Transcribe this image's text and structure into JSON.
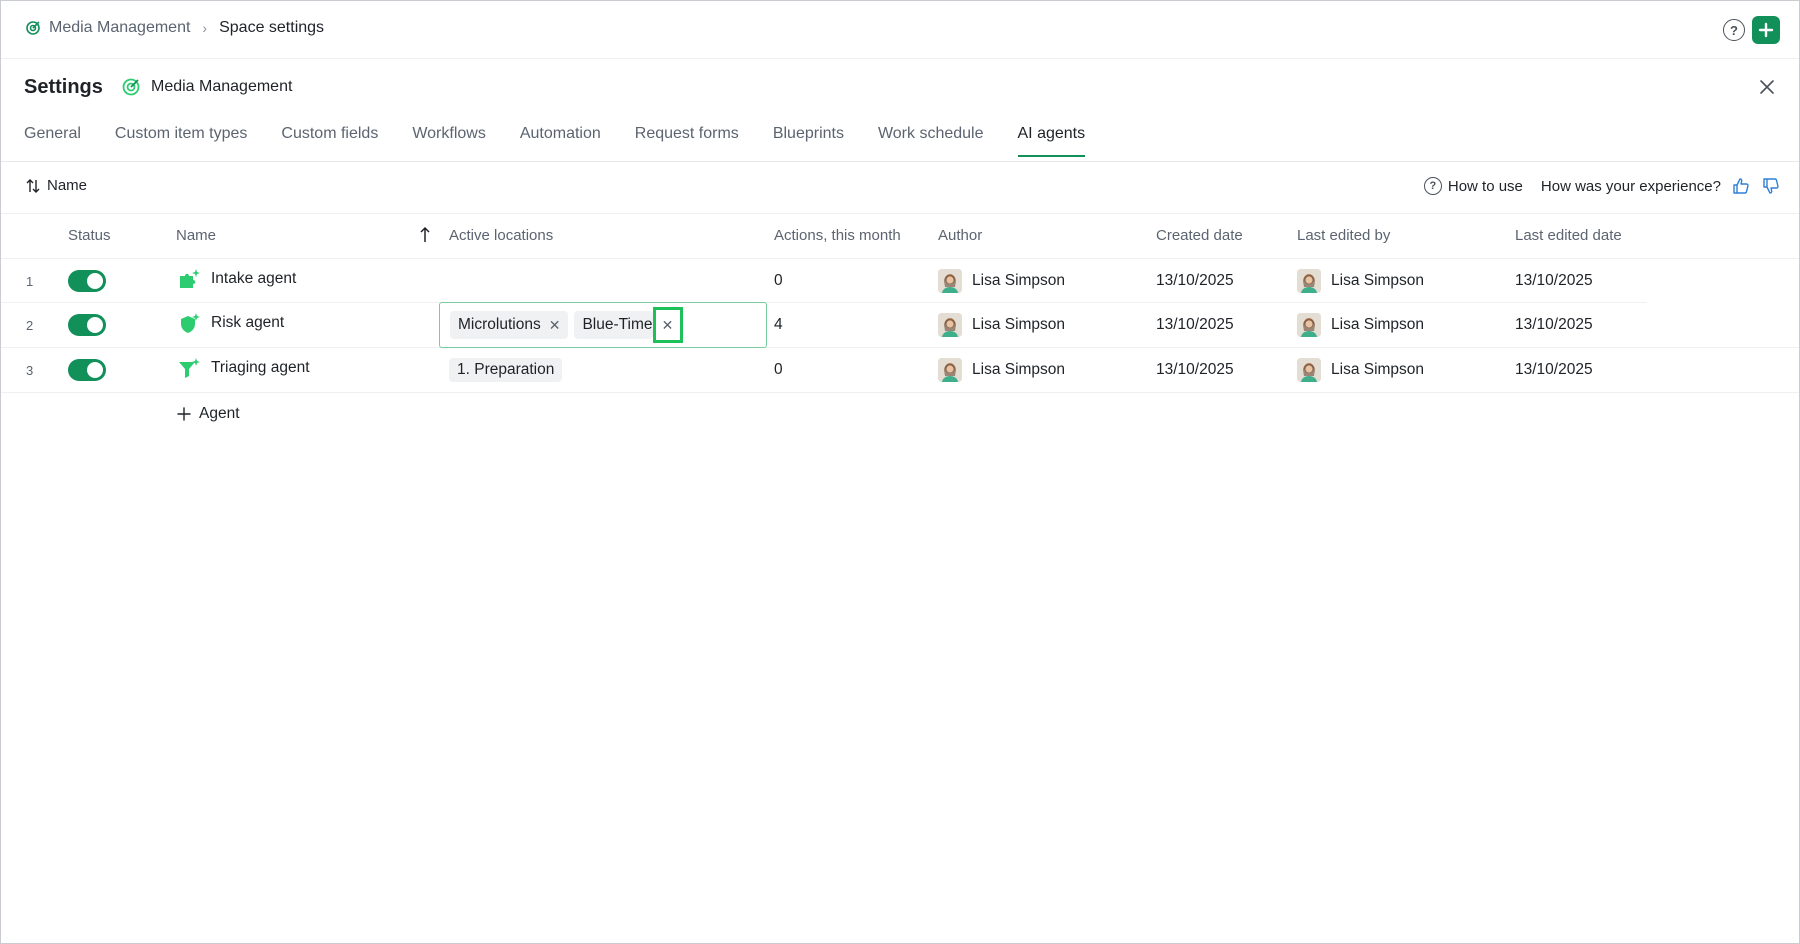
{
  "breadcrumb": {
    "space_link": "Media Management",
    "current": "Space settings"
  },
  "top_actions": {
    "help_glyph": "?",
    "add_glyph": "+"
  },
  "header": {
    "title": "Settings",
    "space_name": "Media Management"
  },
  "tabs": [
    {
      "label": "General"
    },
    {
      "label": "Custom item types"
    },
    {
      "label": "Custom fields"
    },
    {
      "label": "Workflows"
    },
    {
      "label": "Automation"
    },
    {
      "label": "Request forms"
    },
    {
      "label": "Blueprints"
    },
    {
      "label": "Work schedule"
    },
    {
      "label": "AI agents",
      "active": true
    }
  ],
  "toolbar": {
    "sort_label": "Name",
    "how_to_use": "How to use",
    "feedback_prompt": "How was your experience?"
  },
  "columns": {
    "status": "Status",
    "name": "Name",
    "active_locations": "Active locations",
    "actions": "Actions, this month",
    "author": "Author",
    "created": "Created date",
    "last_edited_by": "Last edited by",
    "last_edited_date": "Last edited date"
  },
  "rows": [
    {
      "num": "1",
      "enabled": true,
      "name": "Intake agent",
      "icon": "puzzle-sparkle-icon",
      "locations": [],
      "actions": "0",
      "author": "Lisa Simpson",
      "created": "13/10/2025",
      "last_edited_by": "Lisa Simpson",
      "last_edited_date": "13/10/2025"
    },
    {
      "num": "2",
      "enabled": true,
      "name": "Risk agent",
      "icon": "shield-sparkle-icon",
      "locations": [
        "Microlutions",
        "Blue-Time"
      ],
      "actions": "4",
      "author": "Lisa Simpson",
      "created": "13/10/2025",
      "last_edited_by": "Lisa Simpson",
      "last_edited_date": "13/10/2025"
    },
    {
      "num": "3",
      "enabled": true,
      "name": "Triaging agent",
      "icon": "funnel-sparkle-icon",
      "locations": [
        "1. Preparation"
      ],
      "actions": "0",
      "author": "Lisa Simpson",
      "created": "13/10/2025",
      "last_edited_by": "Lisa Simpson",
      "last_edited_date": "13/10/2025"
    }
  ],
  "add_agent_label": "Agent",
  "colors": {
    "accent": "#12905a",
    "focus_outline": "#1ec05a",
    "agent_icon": "#2ecc71"
  }
}
